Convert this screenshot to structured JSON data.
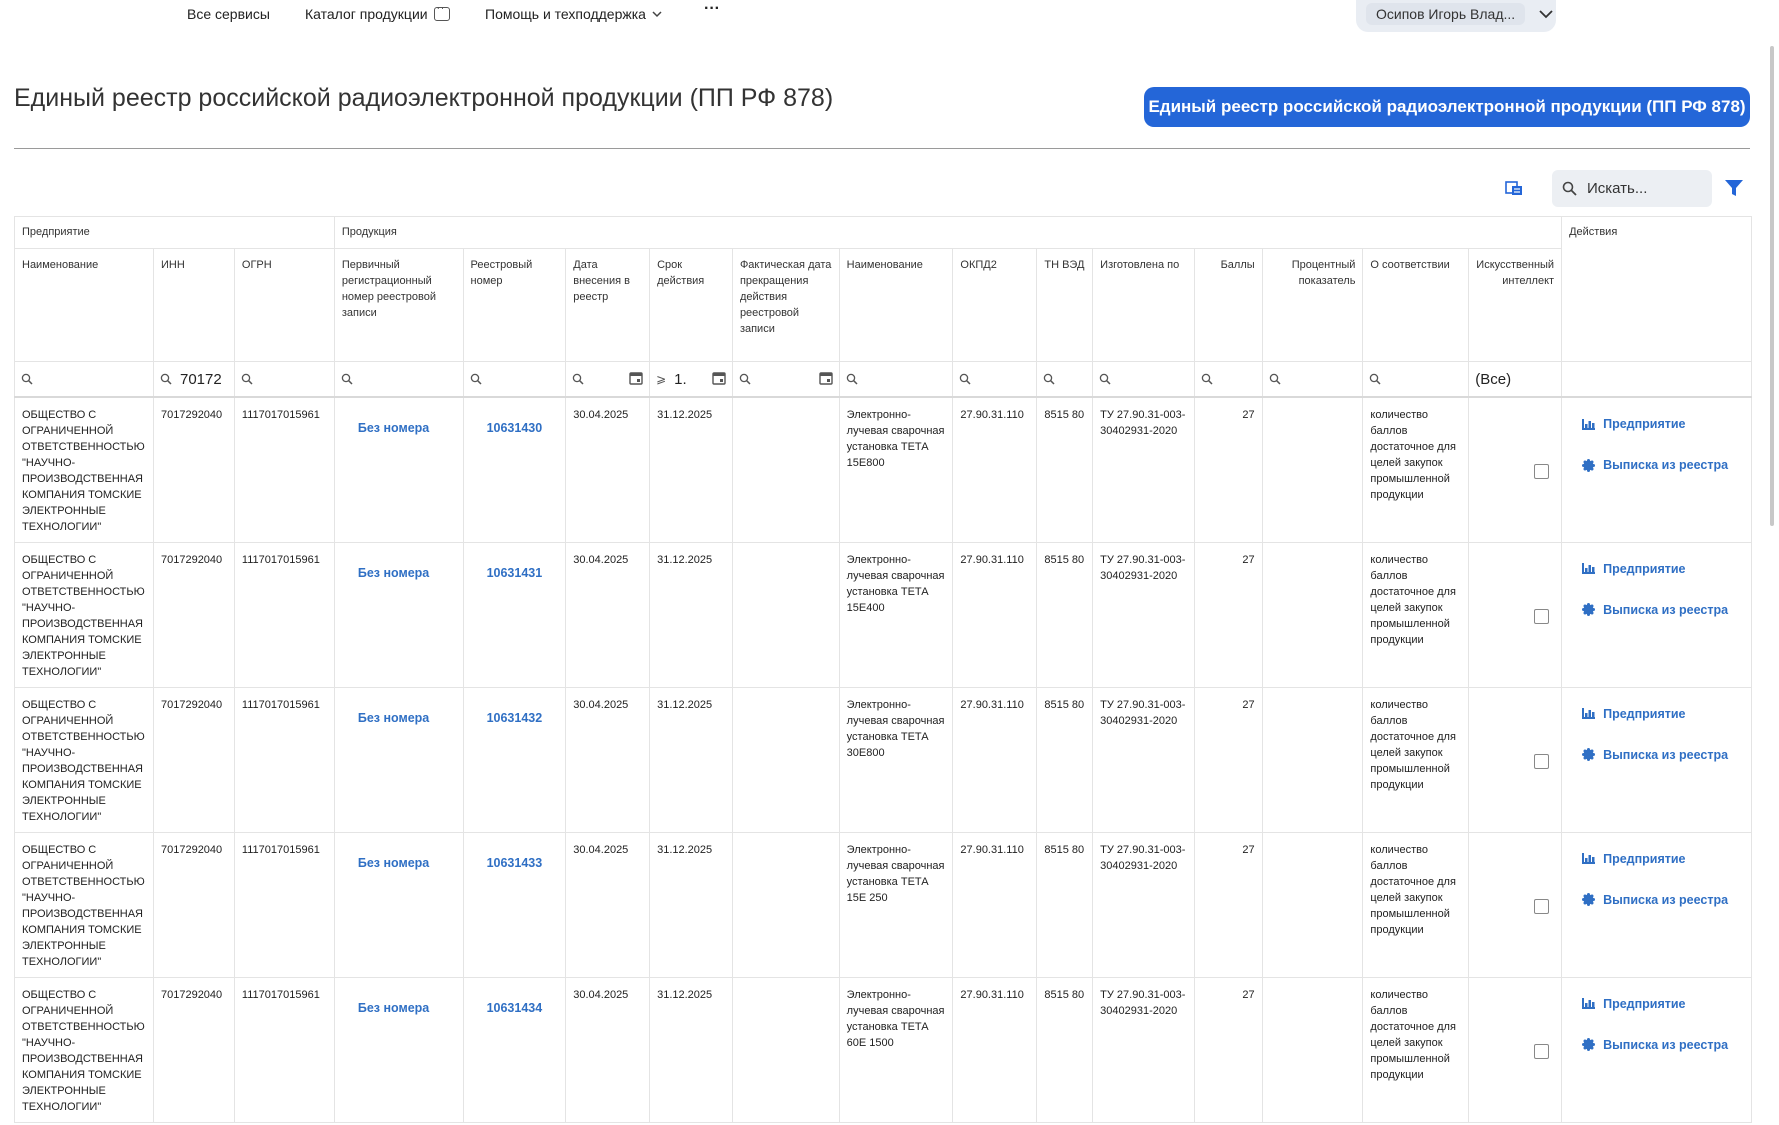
{
  "nav": {
    "items": [
      "Все сервисы",
      "Каталог продукции",
      "Помощь и техподдержка"
    ],
    "more": "···",
    "user_name": "Осипов Игорь Влад..."
  },
  "page": {
    "title": "Единый реестр российской радиоэлектронной продукции (ПП РФ 878)",
    "button_label": "Единый реестр российской радиоэлектронной продукции (ПП РФ 878)"
  },
  "toolbar": {
    "search_placeholder": "Искать..."
  },
  "table": {
    "groups": {
      "enterprise": "Предприятие",
      "product": "Продукция",
      "actions": "Действия"
    },
    "columns": {
      "name": "Наименование",
      "inn": "ИНН",
      "ogrn": "ОГРН",
      "primary_reg": "Первичный регистрационный номер реестровой записи",
      "reg_number": "Реестровый номер",
      "date_added": "Дата внесения в реестр",
      "valid_until": "Срок действия",
      "actual_end": "Фактическая дата прекращения действия реестровой записи",
      "product_name": "Наименование",
      "okpd2": "ОКПД2",
      "tn_ved": "ТН ВЭД",
      "made_by": "Изготовлена по",
      "points": "Баллы",
      "percent": "Процентный показатель",
      "conformity": "О соответствии",
      "ai": "Искусственный интеллект"
    },
    "filters": {
      "inn_value": "70172",
      "valid_value": "1.",
      "ai_value": "(Все)",
      "gte": "⩾"
    },
    "rows": [
      {
        "company": "ОБЩЕСТВО С ОГРАНИЧЕННОЙ ОТВЕТСТВЕННОСТЬЮ \"НАУЧНО-ПРОИЗВОДСТВЕННАЯ КОМПАНИЯ ТОМСКИЕ ЭЛЕКТРОННЫЕ ТЕХНОЛОГИИ\"",
        "inn": "7017292040",
        "ogrn": "1117017015961",
        "primary": "Без номера",
        "reg_number": "10631430",
        "date_added": "30.04.2025",
        "valid_until": "31.12.2025",
        "actual_end": "",
        "product": "Электронно-лучевая сварочная установка ТЕТА 15Е800",
        "okpd2": "27.90.31.110",
        "tn_ved": "8515 80",
        "made_by": "ТУ 27.90.31-003-30402931-2020",
        "points": "27",
        "percent": "",
        "conformity": "количество баллов достаточное для целей закупок промышленной продукции",
        "action_enterprise": "Предприятие",
        "action_extract": "Выписка из реестра"
      },
      {
        "company": "ОБЩЕСТВО С ОГРАНИЧЕННОЙ ОТВЕТСТВЕННОСТЬЮ \"НАУЧНО-ПРОИЗВОДСТВЕННАЯ КОМПАНИЯ ТОМСКИЕ ЭЛЕКТРОННЫЕ ТЕХНОЛОГИИ\"",
        "inn": "7017292040",
        "ogrn": "1117017015961",
        "primary": "Без номера",
        "reg_number": "10631431",
        "date_added": "30.04.2025",
        "valid_until": "31.12.2025",
        "actual_end": "",
        "product": "Электронно-лучевая сварочная установка ТЕТА 15Е400",
        "okpd2": "27.90.31.110",
        "tn_ved": "8515 80",
        "made_by": "ТУ 27.90.31-003-30402931-2020",
        "points": "27",
        "percent": "",
        "conformity": "количество баллов достаточное для целей закупок промышленной продукции",
        "action_enterprise": "Предприятие",
        "action_extract": "Выписка из реестра"
      },
      {
        "company": "ОБЩЕСТВО С ОГРАНИЧЕННОЙ ОТВЕТСТВЕННОСТЬЮ \"НАУЧНО-ПРОИЗВОДСТВЕННАЯ КОМПАНИЯ ТОМСКИЕ ЭЛЕКТРОННЫЕ ТЕХНОЛОГИИ\"",
        "inn": "7017292040",
        "ogrn": "1117017015961",
        "primary": "Без номера",
        "reg_number": "10631432",
        "date_added": "30.04.2025",
        "valid_until": "31.12.2025",
        "actual_end": "",
        "product": "Электронно-лучевая сварочная установка ТЕТА 30Е800",
        "okpd2": "27.90.31.110",
        "tn_ved": "8515 80",
        "made_by": "ТУ 27.90.31-003-30402931-2020",
        "points": "27",
        "percent": "",
        "conformity": "количество баллов достаточное для целей закупок промышленной продукции",
        "action_enterprise": "Предприятие",
        "action_extract": "Выписка из реестра"
      },
      {
        "company": "ОБЩЕСТВО С ОГРАНИЧЕННОЙ ОТВЕТСТВЕННОСТЬЮ \"НАУЧНО-ПРОИЗВОДСТВЕННАЯ КОМПАНИЯ ТОМСКИЕ ЭЛЕКТРОННЫЕ ТЕХНОЛОГИИ\"",
        "inn": "7017292040",
        "ogrn": "1117017015961",
        "primary": "Без номера",
        "reg_number": "10631433",
        "date_added": "30.04.2025",
        "valid_until": "31.12.2025",
        "actual_end": "",
        "product": "Электронно-лучевая сварочная установка ТЕТА 15Е 250",
        "okpd2": "27.90.31.110",
        "tn_ved": "8515 80",
        "made_by": "ТУ 27.90.31-003-30402931-2020",
        "points": "27",
        "percent": "",
        "conformity": "количество баллов достаточное для целей закупок промышленной продукции",
        "action_enterprise": "Предприятие",
        "action_extract": "Выписка из реестра"
      },
      {
        "company": "ОБЩЕСТВО С ОГРАНИЧЕННОЙ ОТВЕТСТВЕННОСТЬЮ \"НАУЧНО-ПРОИЗВОДСТВЕННАЯ КОМПАНИЯ ТОМСКИЕ ЭЛЕКТРОННЫЕ ТЕХНОЛОГИИ\"",
        "inn": "7017292040",
        "ogrn": "1117017015961",
        "primary": "Без номера",
        "reg_number": "10631434",
        "date_added": "30.04.2025",
        "valid_until": "31.12.2025",
        "actual_end": "",
        "product": "Электронно-лучевая сварочная установка ТЕТА 60Е 1500",
        "okpd2": "27.90.31.110",
        "tn_ved": "8515 80",
        "made_by": "ТУ 27.90.31-003-30402931-2020",
        "points": "27",
        "percent": "",
        "conformity": "количество баллов достаточное для целей закупок промышленной продукции",
        "action_enterprise": "Предприятие",
        "action_extract": "Выписка из реестра"
      }
    ]
  },
  "colors": {
    "accent": "#2466d8",
    "link": "#2f6fc4"
  }
}
